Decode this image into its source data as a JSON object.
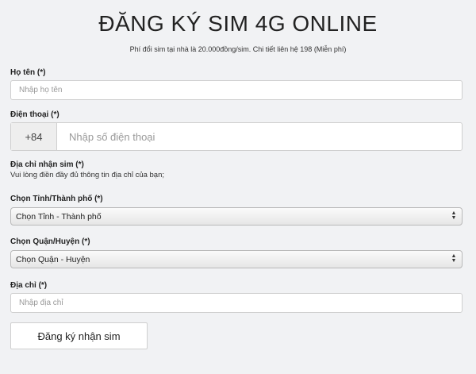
{
  "header": {
    "title": "ĐĂNG KÝ SIM 4G ONLINE",
    "subtitle": "Phí đổi sim tại nhà là 20.000đồng/sim. Chi tiết liên hệ 198 (Miễn phí)"
  },
  "form": {
    "name": {
      "label": "Họ tên (*)",
      "placeholder": "Nhập họ tên"
    },
    "phone": {
      "label": "Điện thoại (*)",
      "prefix": "+84",
      "placeholder": "Nhập số điện thoại"
    },
    "address_section": {
      "label": "Địa chỉ nhận sim (*)",
      "hint": "Vui lòng điền đầy đủ thông tin địa chỉ của bạn;"
    },
    "province": {
      "label": "Chọn Tỉnh/Thành phố (*)",
      "selected": "Chọn Tỉnh - Thành phố"
    },
    "district": {
      "label": "Chọn Quận/Huyện (*)",
      "selected": "Chọn Quận - Huyện"
    },
    "address": {
      "label": "Địa chỉ (*)",
      "placeholder": "Nhập địa chỉ"
    },
    "submit_label": "Đăng ký nhận sim"
  }
}
